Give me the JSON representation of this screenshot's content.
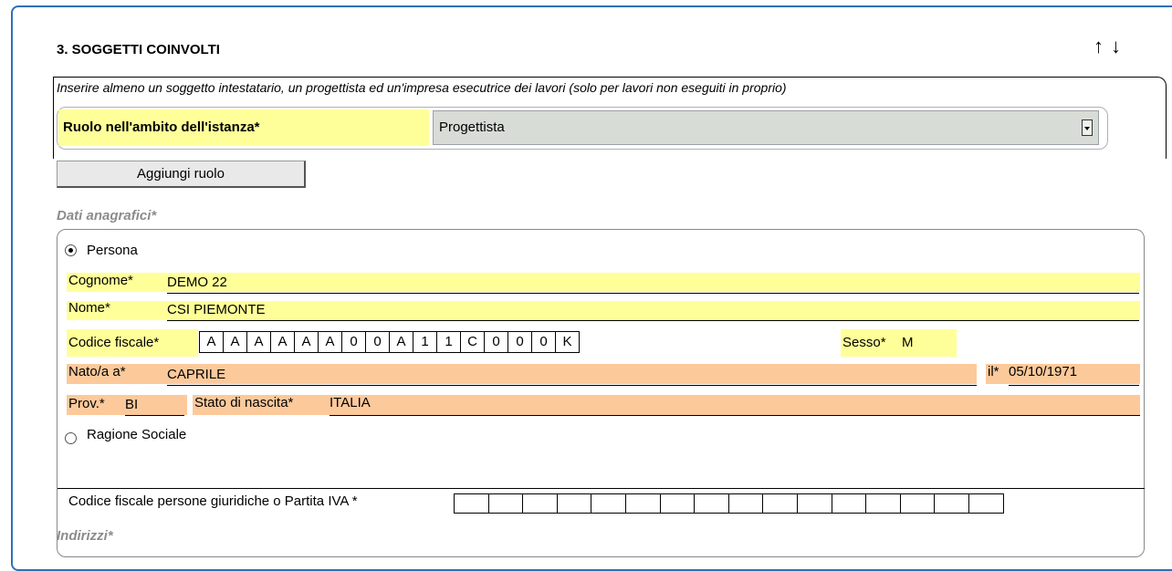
{
  "section": {
    "title": "3. SOGGETTI COINVOLTI",
    "up_arrow": "↑",
    "down_arrow": "↓",
    "instructions": "Inserire almeno un soggetto intestatario, un progettista ed un'impresa esecutrice dei lavori (solo per lavori non eseguiti in proprio)"
  },
  "role": {
    "label": "Ruolo nell'ambito dell'istanza*",
    "selected": "Progettista",
    "add_button": "Aggiungi ruolo"
  },
  "anagrafica": {
    "section_label": "Dati anagrafici*",
    "persona_option": "Persona",
    "persona_checked": true,
    "cognome_label": "Cognome*",
    "cognome_value": "DEMO 22",
    "nome_label": "Nome*",
    "nome_value": "CSI PIEMONTE",
    "cf_label": "Codice fiscale*",
    "cf_chars": [
      "A",
      "A",
      "A",
      "A",
      "A",
      "A",
      "0",
      "0",
      "A",
      "1",
      "1",
      "C",
      "0",
      "0",
      "0",
      "K"
    ],
    "sesso_label": "Sesso*",
    "sesso_value": "M",
    "nato_label": "Nato/a a*",
    "nato_value": "CAPRILE",
    "il_label": "il*",
    "il_value": "05/10/1971",
    "prov_label": "Prov.*",
    "prov_value": "BI",
    "stato_label": "Stato di nascita*",
    "stato_value": "ITALIA",
    "ragione_option": "Ragione Sociale",
    "ragione_checked": false,
    "piva_label": "Codice fiscale persone giuridiche o Partita IVA *",
    "piva_cells": 16
  },
  "indirizzi": {
    "section_label": "Indirizzi*"
  },
  "colors": {
    "frame_border": "#2f6fb5",
    "yellow_field": "#ffff99",
    "orange_field": "#fcc99b",
    "select_bg": "#d7dcd6"
  }
}
